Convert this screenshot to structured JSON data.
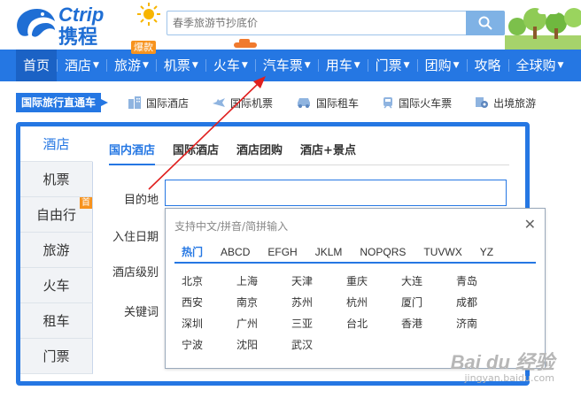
{
  "header": {
    "logo_en": "Ctrip",
    "logo_cn": "携程",
    "search_placeholder": "春季旅游节抄底价"
  },
  "nav": {
    "items": [
      {
        "label": "首页",
        "caret": false,
        "active": true
      },
      {
        "label": "酒店",
        "caret": true
      },
      {
        "label": "旅游",
        "caret": true
      },
      {
        "label": "机票",
        "caret": true
      },
      {
        "label": "火车",
        "caret": true
      },
      {
        "label": "汽车票",
        "caret": true
      },
      {
        "label": "用车",
        "caret": true
      },
      {
        "label": "门票",
        "caret": true
      },
      {
        "label": "团购",
        "caret": true
      },
      {
        "label": "攻略",
        "caret": false
      },
      {
        "label": "全球购",
        "caret": true
      }
    ],
    "hot_badge": "爆款",
    "caret_glyph": "▼"
  },
  "intl": {
    "title": "国际旅行直通车",
    "links": [
      {
        "label": "国际酒店",
        "icon": "hotel-building-icon"
      },
      {
        "label": "国际机票",
        "icon": "airplane-icon"
      },
      {
        "label": "国际租车",
        "icon": "car-icon"
      },
      {
        "label": "国际火车票",
        "icon": "train-icon"
      },
      {
        "label": "出境旅游",
        "icon": "globe-flag-icon"
      }
    ]
  },
  "widget": {
    "vtabs": [
      {
        "label": "酒店",
        "active": true
      },
      {
        "label": "机票"
      },
      {
        "label": "自由行",
        "badge": "首"
      },
      {
        "label": "旅游"
      },
      {
        "label": "火车"
      },
      {
        "label": "租车"
      },
      {
        "label": "门票"
      }
    ],
    "htabs": [
      {
        "label": "国内酒店",
        "active": true
      },
      {
        "label": "国际酒店"
      },
      {
        "label": "酒店团购"
      },
      {
        "label": "酒店+景点"
      }
    ],
    "labels": {
      "destination": "目的地",
      "checkin": "入住日期",
      "level": "酒店级别",
      "keyword": "关键词"
    }
  },
  "dropdown": {
    "hint": "支持中文/拼音/简拼输入",
    "close": "✕",
    "tabs": [
      {
        "label": "热门",
        "active": true
      },
      {
        "label": "ABCD"
      },
      {
        "label": "EFGH"
      },
      {
        "label": "JKLM"
      },
      {
        "label": "NOPQRS"
      },
      {
        "label": "TUVWX"
      },
      {
        "label": "YZ"
      }
    ],
    "cities": [
      "北京",
      "上海",
      "天津",
      "重庆",
      "大连",
      "青岛",
      "西安",
      "南京",
      "苏州",
      "杭州",
      "厦门",
      "成都",
      "深圳",
      "广州",
      "三亚",
      "台北",
      "香港",
      "济南",
      "宁波",
      "沈阳",
      "武汉"
    ]
  },
  "colors": {
    "brand_blue": "#2577e3",
    "annotation_red": "#e0201f",
    "badge_orange": "#f7931e"
  },
  "watermark": {
    "main": "Bai du 经验",
    "sub": "jingyan.baidu.com"
  }
}
